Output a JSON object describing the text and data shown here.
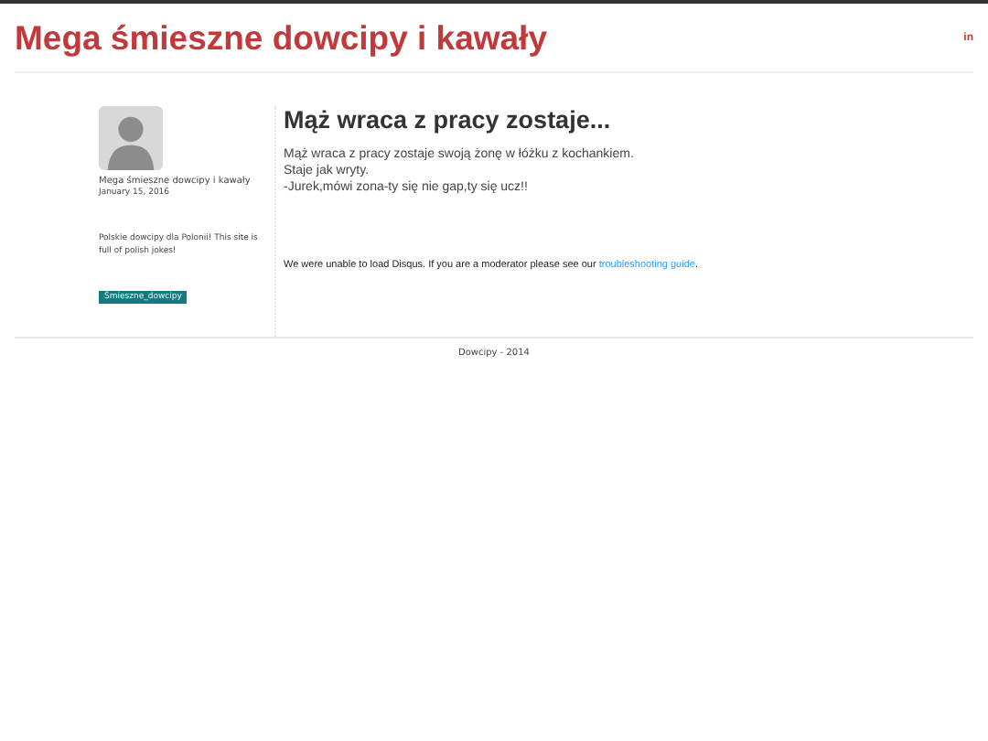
{
  "header": {
    "site_title": "Mega śmieszne dowcipy i kawały",
    "social_link": "in"
  },
  "sidebar": {
    "author": "Mega śmieszne dowcipy i kawały",
    "date": "January 15, 2016",
    "description": "Polskie dowcipy dla Polonii! This site is full of polish jokes!",
    "tags": [
      "Śmieszne_dowcipy"
    ]
  },
  "post": {
    "title": "Mąż wraca z pracy zostaje...",
    "lines": [
      "Mąż wraca z pracy zostaje swoją żonę w łóżku z kochankiem.",
      "Staje jak wryty.",
      "-Jurek,mówi zona-ty się nie gap,ty się ucz!!"
    ]
  },
  "comments": {
    "message": "We were unable to load Disqus. If you are a moderator please see our",
    "link": "troubleshooting guide",
    "after": "."
  },
  "footer": {
    "text": "Dowcipy - 2014"
  }
}
